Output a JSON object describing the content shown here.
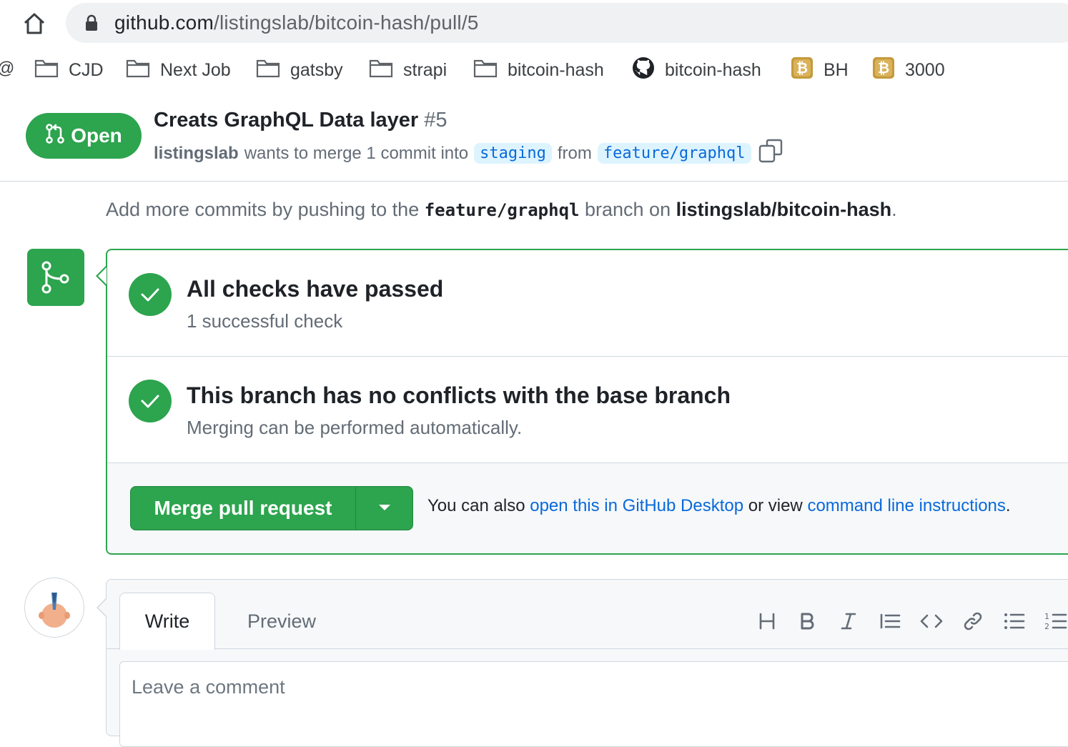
{
  "browser": {
    "url_host": "github.com",
    "url_path": "/listingslab/bitcoin-hash/pull/5",
    "bookmarks_partial": "@",
    "bookmarks": [
      {
        "label": "CJD",
        "icon": "folder-icon"
      },
      {
        "label": "Next Job",
        "icon": "folder-icon"
      },
      {
        "label": "gatsby",
        "icon": "folder-icon"
      },
      {
        "label": "strapi",
        "icon": "folder-icon"
      },
      {
        "label": "bitcoin-hash",
        "icon": "folder-icon"
      },
      {
        "label": "bitcoin-hash",
        "icon": "github-icon"
      },
      {
        "label": "BH",
        "icon": "bitcoin-icon"
      },
      {
        "label": "3000",
        "icon": "bitcoin-icon"
      }
    ]
  },
  "pr": {
    "state": "Open",
    "title": "Creats GraphQL Data layer",
    "number": "#5",
    "author": "listingslab",
    "meta_text": "wants to merge 1 commit into",
    "base_branch": "staging",
    "from_text": "from",
    "head_branch": "feature/graphql"
  },
  "hint": {
    "prefix": "Add more commits by pushing to the",
    "branch": "feature/graphql",
    "middle": "branch on",
    "repo": "listingslab/bitcoin-hash",
    "suffix": "."
  },
  "merge_box": {
    "checks_title": "All checks have passed",
    "checks_sub": "1 successful check",
    "conflicts_title": "This branch has no conflicts with the base branch",
    "conflicts_sub": "Merging can be performed automatically.",
    "merge_button": "Merge pull request",
    "alt_prefix": "You can also",
    "alt_link1": "open this in GitHub Desktop",
    "alt_middle": "or view",
    "alt_link2": "command line instructions",
    "alt_suffix": "."
  },
  "comment": {
    "tab_write": "Write",
    "tab_preview": "Preview",
    "placeholder": "Leave a comment",
    "toolbar": [
      "heading-icon",
      "bold-icon",
      "italic-icon",
      "quote-icon",
      "code-icon",
      "link-icon",
      "unordered-list-icon",
      "ordered-list-icon"
    ]
  },
  "colors": {
    "success": "#2da44e",
    "link": "#0969da",
    "muted": "#636c76"
  }
}
